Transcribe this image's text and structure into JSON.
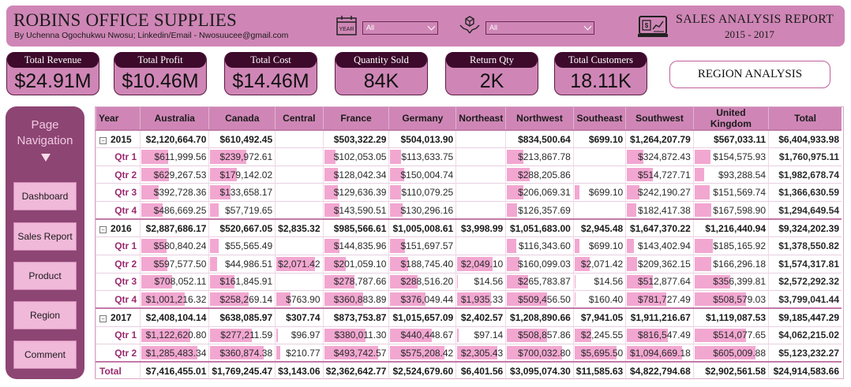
{
  "header": {
    "brand": "ROBINS OFFICE SUPPLIES",
    "byline": "By Uchenna Ogochukwu Nwosu; Linkedin/Email - Nwosuucee@gmail.com",
    "year_slicer": {
      "icon": "calendar-icon",
      "icon_text": "YEAR",
      "value": "All"
    },
    "product_slicer": {
      "icon": "box-hands-icon",
      "value": "All"
    },
    "report_title": "SALES ANALYSIS REPORT",
    "report_years": "2015 - 2017",
    "report_icon": "analytics-monitor-icon"
  },
  "kpis": [
    {
      "label": "Total Revenue",
      "value": "$24.91M"
    },
    {
      "label": "Total Profit",
      "value": "$10.46M"
    },
    {
      "label": "Total Cost",
      "value": "$14.46M"
    },
    {
      "label": "Quantity Sold",
      "value": "84K"
    },
    {
      "label": "Return Qty",
      "value": "2K"
    },
    {
      "label": "Total Customers",
      "value": "18.11K"
    }
  ],
  "region_button": "REGION ANALYSIS",
  "nav": {
    "title": "Page Navigation",
    "buttons": [
      "Dashboard",
      "Sales Report",
      "Product",
      "Region",
      "Comment"
    ]
  },
  "table": {
    "columns": [
      "Year",
      "Australia",
      "Canada",
      "Central",
      "France",
      "Germany",
      "Northeast",
      "Northwest",
      "Southeast",
      "Southwest",
      "United Kingdom",
      "Total"
    ],
    "rows": [
      {
        "type": "year",
        "label": "2015",
        "cells": [
          "$2,120,664.70",
          "$610,492.45",
          "",
          "$503,322.29",
          "$504,013.90",
          "",
          "$834,500.64",
          "$699.10",
          "$1,264,207.79",
          "$567,033.11",
          "$6,404,933.98"
        ]
      },
      {
        "type": "qtr",
        "label": "Qtr 1",
        "cells": [
          "$611,999.56",
          "$239,972.61",
          "",
          "$102,053.05",
          "$113,633.75",
          "",
          "$213,867.78",
          "",
          "$324,872.43",
          "$154,575.93",
          "$1,760,975.11"
        ]
      },
      {
        "type": "qtr",
        "label": "Qtr 2",
        "cells": [
          "$629,267.53",
          "$179,142.02",
          "",
          "$128,042.34",
          "$150,004.74",
          "",
          "$288,205.86",
          "",
          "$514,727.71",
          "$93,288.54",
          "$1,982,678.74"
        ]
      },
      {
        "type": "qtr",
        "label": "Qtr 3",
        "cells": [
          "$392,728.36",
          "$133,658.17",
          "",
          "$129,636.39",
          "$110,079.25",
          "",
          "$206,069.31",
          "$699.10",
          "$242,190.27",
          "$151,569.74",
          "$1,366,630.59"
        ]
      },
      {
        "type": "qtr",
        "label": "Qtr 4",
        "cells": [
          "$486,669.25",
          "$57,719.65",
          "",
          "$143,590.51",
          "$130,296.16",
          "",
          "$126,357.69",
          "",
          "$182,417.38",
          "$167,598.90",
          "$1,294,649.54"
        ]
      },
      {
        "type": "year",
        "label": "2016",
        "cells": [
          "$2,887,686.17",
          "$520,667.05",
          "$2,835.32",
          "$985,566.61",
          "$1,005,008.61",
          "$3,998.99",
          "$1,051,683.00",
          "$2,945.48",
          "$1,647,370.22",
          "$1,216,440.94",
          "$9,324,202.39"
        ]
      },
      {
        "type": "qtr",
        "label": "Qtr 1",
        "cells": [
          "$580,840.24",
          "$55,565.49",
          "",
          "$144,835.96",
          "$151,697.57",
          "",
          "$116,343.60",
          "$699.10",
          "$143,402.94",
          "$185,165.92",
          "$1,378,550.82"
        ]
      },
      {
        "type": "qtr",
        "label": "Qtr 2",
        "cells": [
          "$597,577.50",
          "$44,986.51",
          "$2,071.42",
          "$201,059.10",
          "$188,745.40",
          "$2,049.10",
          "$160,099.03",
          "$2,071.42",
          "$209,362.15",
          "$166,296.18",
          "$1,574,317.81"
        ]
      },
      {
        "type": "qtr",
        "label": "Qtr 3",
        "cells": [
          "$708,052.11",
          "$161,845.91",
          "",
          "$278,787.66",
          "$288,516.20",
          "$14.56",
          "$265,783.87",
          "$14.56",
          "$512,877.64",
          "$356,399.81",
          "$2,572,292.32"
        ]
      },
      {
        "type": "qtr",
        "label": "Qtr 4",
        "cells": [
          "$1,001,216.32",
          "$258,269.14",
          "$763.90",
          "$360,883.89",
          "$376,049.44",
          "$1,935.33",
          "$509,456.50",
          "$160.40",
          "$781,727.49",
          "$508,579.03",
          "$3,799,041.44"
        ]
      },
      {
        "type": "year",
        "label": "2017",
        "cells": [
          "$2,408,104.14",
          "$638,085.97",
          "$307.74",
          "$873,753.87",
          "$1,015,657.09",
          "$2,402.57",
          "$1,208,890.66",
          "$7,941.05",
          "$1,911,216.67",
          "$1,119,087.53",
          "$9,185,447.29"
        ]
      },
      {
        "type": "qtr",
        "label": "Qtr 1",
        "cells": [
          "$1,122,620.80",
          "$277,211.59",
          "$96.97",
          "$380,011.30",
          "$440,448.67",
          "$97.14",
          "$508,857.86",
          "$2,245.55",
          "$816,547.49",
          "$514,077.65",
          "$4,062,215.02"
        ]
      },
      {
        "type": "qtr",
        "label": "Qtr 2",
        "cells": [
          "$1,285,483.34",
          "$360,874.38",
          "$210.77",
          "$493,742.57",
          "$575,208.42",
          "$2,305.43",
          "$700,032.80",
          "$5,695.50",
          "$1,094,669.18",
          "$605,009.88",
          "$5,123,232.27"
        ]
      },
      {
        "type": "total",
        "label": "Total",
        "cells": [
          "$7,416,455.01",
          "$1,769,245.47",
          "$3,143.06",
          "$2,362,642.77",
          "$2,524,679.60",
          "$6,401.56",
          "$3,095,074.30",
          "$11,585.63",
          "$4,822,794.68",
          "$2,902,561.58",
          "$24,914,583.66"
        ]
      }
    ]
  }
}
